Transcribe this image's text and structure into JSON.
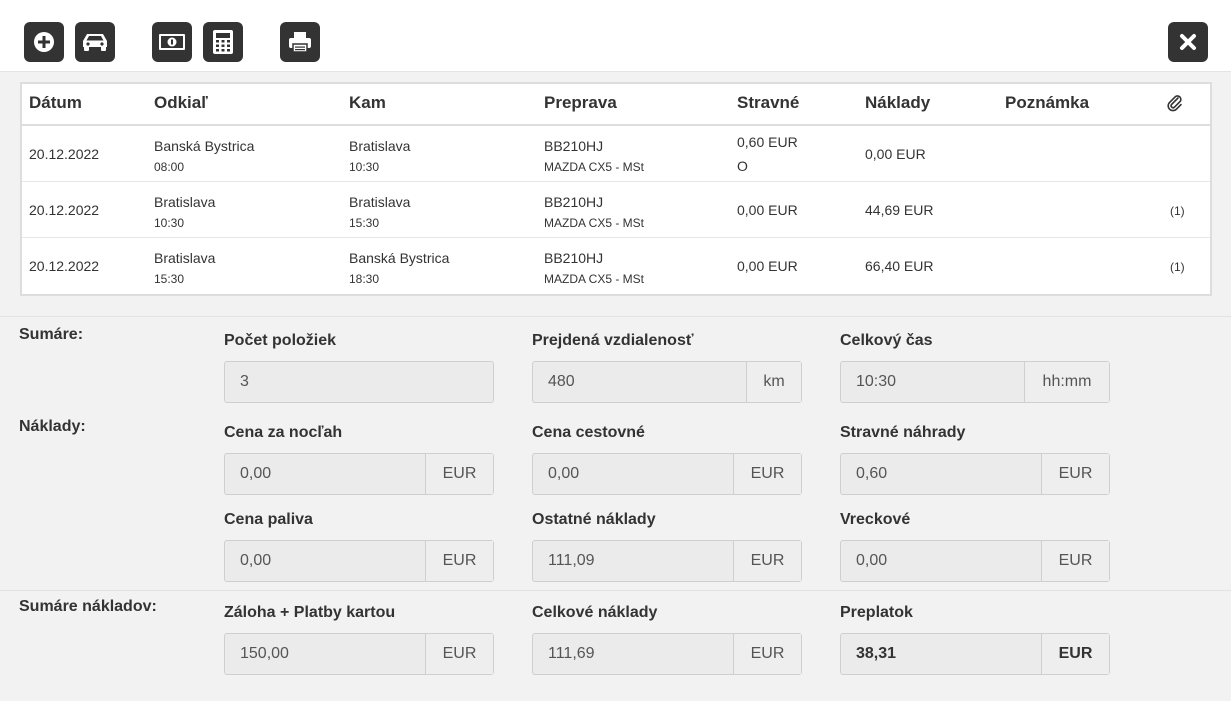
{
  "toolbar": {
    "buttons": [
      "add-icon",
      "car-icon",
      "money-icon",
      "calculator-icon",
      "print-icon",
      "close-icon"
    ]
  },
  "table": {
    "headers": {
      "datum": "Dátum",
      "odkial": "Odkiaľ",
      "kam": "Kam",
      "preprava": "Preprava",
      "stravne": "Stravné",
      "naklady": "Náklady",
      "poznamka": "Poznámka"
    },
    "rows": [
      {
        "datum": "20.12.2022",
        "odkial": "Banská Bystrica",
        "odkial_time": "08:00",
        "kam": "Bratislava",
        "kam_time": "10:30",
        "spz": "BB210HJ",
        "vozidlo": "MAZDA CX5 - MSt",
        "stravne": "0,60 EUR",
        "stravne_note": "O",
        "naklady": "0,00 EUR",
        "poznamka": "",
        "prilohy": ""
      },
      {
        "datum": "20.12.2022",
        "odkial": "Bratislava",
        "odkial_time": "10:30",
        "kam": "Bratislava",
        "kam_time": "15:30",
        "spz": "BB210HJ",
        "vozidlo": "MAZDA CX5 - MSt",
        "stravne": "0,00 EUR",
        "stravne_note": "",
        "naklady": "44,69 EUR",
        "poznamka": "",
        "prilohy": "(1)"
      },
      {
        "datum": "20.12.2022",
        "odkial": "Bratislava",
        "odkial_time": "15:30",
        "kam": "Banská Bystrica",
        "kam_time": "18:30",
        "spz": "BB210HJ",
        "vozidlo": "MAZDA CX5 - MSt",
        "stravne": "0,00 EUR",
        "stravne_note": "",
        "naklady": "66,40 EUR",
        "poznamka": "",
        "prilohy": "(1)"
      }
    ]
  },
  "sections": {
    "sumare": "Sumáre:",
    "naklady": "Náklady:",
    "sumare_nakladov": "Sumáre nákladov:"
  },
  "fields": {
    "pocet_poloziek": {
      "label": "Počet položiek",
      "value": "3"
    },
    "prejdena_vzdialenost": {
      "label": "Prejdená vzdialenosť",
      "value": "480",
      "unit": "km"
    },
    "celkovy_cas": {
      "label": "Celkový čas",
      "value": "10:30",
      "unit": "hh:mm"
    },
    "cena_za_noclah": {
      "label": "Cena za nocľah",
      "value": "0,00",
      "unit": "EUR"
    },
    "cena_cestovne": {
      "label": "Cena cestovné",
      "value": "0,00",
      "unit": "EUR"
    },
    "stravne_nahrady": {
      "label": "Stravné náhrady",
      "value": "0,60",
      "unit": "EUR"
    },
    "cena_paliva": {
      "label": "Cena paliva",
      "value": "0,00",
      "unit": "EUR"
    },
    "ostatne_naklady": {
      "label": "Ostatné náklady",
      "value": "111,09",
      "unit": "EUR"
    },
    "vreckove": {
      "label": "Vreckové",
      "value": "0,00",
      "unit": "EUR"
    },
    "zaloha": {
      "label": "Záloha + Platby kartou",
      "value": "150,00",
      "unit": "EUR"
    },
    "celkove_naklady": {
      "label": "Celkové náklady",
      "value": "111,69",
      "unit": "EUR"
    },
    "preplatok": {
      "label": "Preplatok",
      "value": "38,31",
      "unit": "EUR"
    }
  }
}
